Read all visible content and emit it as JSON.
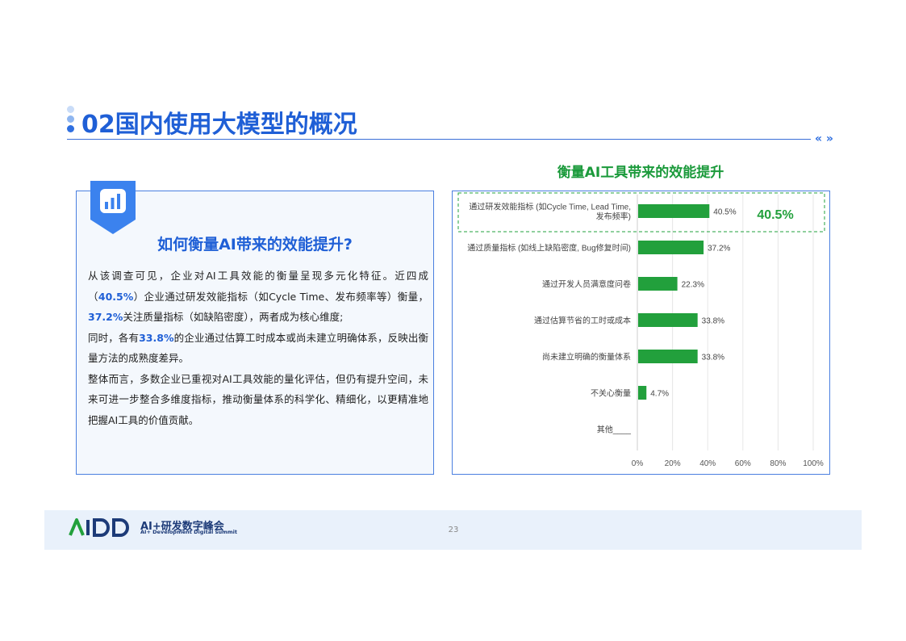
{
  "header": {
    "title": "02国内使用大模型的概况",
    "nav_arrows": "« »"
  },
  "left_panel": {
    "title": "如何衡量AI带来的效能提升?",
    "paragraph1_a": "从该调查可见，企业对AI工具效能的衡量呈现多元化特征。近四成（",
    "paragraph1_hl1": "40.5%",
    "paragraph1_b": "）企业通过研发效能指标（如Cycle Time、发布频率等）衡量，",
    "paragraph1_hl2": "37.2%",
    "paragraph1_c": "关注质量指标（如缺陷密度），两者成为核心维度;",
    "paragraph2_a": "同时，各有",
    "paragraph2_hl": "33.8%",
    "paragraph2_b": "的企业通过估算工时成本或尚未建立明确体系，反映出衡量方法的成熟度差异。",
    "paragraph3": "整体而言，多数企业已重视对AI工具效能的量化评估，但仍有提升空间，未来可进一步整合多维度指标，推动衡量体系的科学化、精细化，以更精准地把握AI工具的价值贡献。"
  },
  "chart_data": {
    "type": "bar",
    "orientation": "horizontal",
    "title": "衡量AI工具带来的效能提升",
    "categories": [
      "通过研发效能指标 (如Cycle Time, Lead Time, 发布频率)",
      "通过质量指标 (如线上缺陷密度, Bug修复时间)",
      "通过开发人员满意度问卷",
      "通过估算节省的工时或成本",
      "尚未建立明确的衡量体系",
      "不关心衡量",
      "其他____"
    ],
    "category_lines": [
      [
        "通过研发效能指标 (如Cycle Time, Lead Time,",
        "发布频率)"
      ],
      [
        "通过质量指标 (如线上缺陷密度, Bug修复时间)"
      ],
      [
        "通过开发人员满意度问卷"
      ],
      [
        "通过估算节省的工时或成本"
      ],
      [
        "尚未建立明确的衡量体系"
      ],
      [
        "不关心衡量"
      ],
      [
        "其他____"
      ]
    ],
    "values": [
      40.5,
      37.2,
      22.3,
      33.8,
      33.8,
      4.7,
      null
    ],
    "value_labels": [
      "40.5%",
      "37.2%",
      "22.3%",
      "33.8%",
      "33.8%",
      "4.7%",
      ""
    ],
    "xlim": [
      0,
      100
    ],
    "x_ticks": [
      "0%",
      "20%",
      "40%",
      "60%",
      "80%",
      "100%"
    ],
    "highlight_label": "40.5%",
    "bar_color": "#22a03c",
    "grid": true
  },
  "footer": {
    "brand": "AI+研发数字峰会",
    "sub": "AI+ Development Digital summit",
    "page_number": "23"
  }
}
